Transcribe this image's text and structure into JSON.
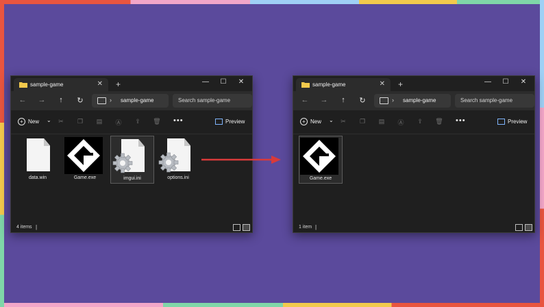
{
  "colors": {
    "background": "#5b4a9c",
    "window": "#1f1f1f",
    "arrow": "#d93a3a",
    "folder": "#f2c94c"
  },
  "left_window": {
    "tab_title": "sample-game",
    "address": "sample-game",
    "search_placeholder": "Search sample-game",
    "new_label": "New",
    "preview_label": "Preview",
    "files": [
      {
        "name": "data.win",
        "icon": "document-icon"
      },
      {
        "name": "Game.exe",
        "icon": "gamemaker-icon"
      },
      {
        "name": "imgui.ini",
        "icon": "settings-file-icon",
        "selected": true
      },
      {
        "name": "options.ini",
        "icon": "settings-file-icon"
      }
    ],
    "status_count": "4 items"
  },
  "right_window": {
    "tab_title": "sample-game",
    "address": "sample-game",
    "search_placeholder": "Search sample-game",
    "new_label": "New",
    "preview_label": "Preview",
    "files": [
      {
        "name": "Game.exe",
        "icon": "gamemaker-icon",
        "selected": true
      }
    ],
    "status_count": "1 item"
  },
  "glyphs": {
    "close": "✕",
    "plus": "+",
    "minimize": "—",
    "maximize": "☐",
    "back": "←",
    "forward": "→",
    "up": "↑",
    "refresh": "↻",
    "chevron": "›",
    "more": "•••",
    "separator": "|",
    "new_plus": "+",
    "new_chev": "⌄"
  }
}
